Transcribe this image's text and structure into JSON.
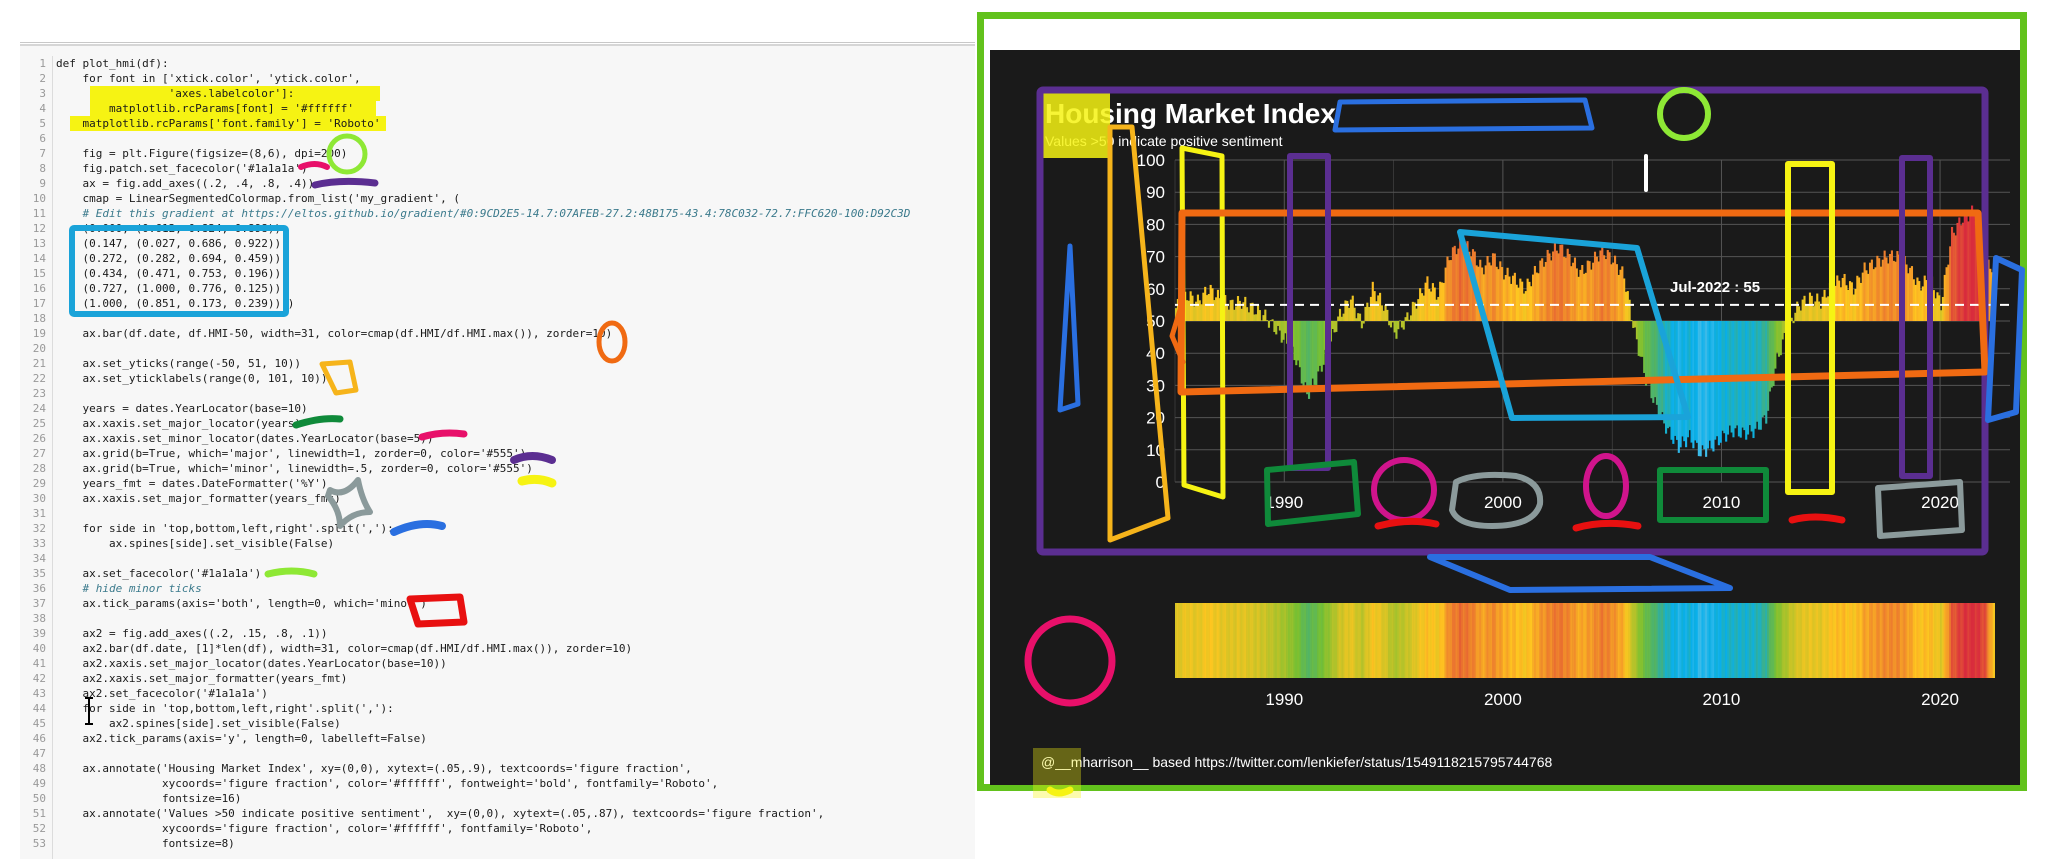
{
  "code_lines": [
    "def plot_hmi(df):",
    "    for font in ['xtick.color', 'ytick.color',",
    "                 'axes.labelcolor']:",
    "        matplotlib.rcParams[font] = '#ffffff'",
    "    matplotlib.rcParams['font.family'] = 'Roboto'",
    "",
    "    fig = plt.Figure(figsize=(8,6), dpi=200)",
    "    fig.patch.set_facecolor('#1a1a1a')",
    "    ax = fig.add_axes((.2, .4, .8, .4))",
    "    cmap = LinearSegmentedColormap.from_list('my_gradient', (",
    "    # Edit this gradient at https://eltos.github.io/gradient/#0:9CD2E5-14.7:07AFEB-27.2:48B175-43.4:78C032-72.7:FFC620-100:D92C3D",
    "    (0.000, (0.612, 0.824, 0.898)),",
    "    (0.147, (0.027, 0.686, 0.922)),",
    "    (0.272, (0.282, 0.694, 0.459)),",
    "    (0.434, (0.471, 0.753, 0.196)),",
    "    (0.727, (1.000, 0.776, 0.125)),",
    "    (1.000, (0.851, 0.173, 0.239))))",
    "",
    "    ax.bar(df.date, df.HMI-50, width=31, color=cmap(df.HMI/df.HMI.max()), zorder=10)",
    "",
    "    ax.set_yticks(range(-50, 51, 10))",
    "    ax.set_yticklabels(range(0, 101, 10))",
    "",
    "    years = dates.YearLocator(base=10)",
    "    ax.xaxis.set_major_locator(years)",
    "    ax.xaxis.set_minor_locator(dates.YearLocator(base=5))",
    "    ax.grid(b=True, which='major', linewidth=1, zorder=0, color='#555')",
    "    ax.grid(b=True, which='minor', linewidth=.5, zorder=0, color='#555')",
    "    years_fmt = dates.DateFormatter('%Y')",
    "    ax.xaxis.set_major_formatter(years_fmt)",
    "",
    "    for side in 'top,bottom,left,right'.split(','):",
    "        ax.spines[side].set_visible(False)",
    "",
    "    ax.set_facecolor('#1a1a1a')",
    "    # hide minor ticks",
    "    ax.tick_params(axis='both', length=0, which='minor')",
    "",
    "    ax2 = fig.add_axes((.2, .15, .8, .1))",
    "    ax2.bar(df.date, [1]*len(df), width=31, color=cmap(df.HMI/df.HMI.max()), zorder=10)",
    "    ax2.xaxis.set_major_locator(dates.YearLocator(base=10))",
    "    ax2.xaxis.set_major_formatter(years_fmt)",
    "    ax2.set_facecolor('#1a1a1a')",
    "    for side in 'top,bottom,left,right'.split(','):",
    "        ax2.spines[side].set_visible(False)",
    "    ax2.tick_params(axis='y', length=0, labelleft=False)",
    "",
    "    ax.annotate('Housing Market Index', xy=(0,0), xytext=(.05,.9), textcoords='figure fraction',",
    "                xycoords='figure fraction', color='#ffffff', fontweight='bold', fontfamily='Roboto',",
    "                fontsize=16)",
    "    ax.annotate('Values >50 indicate positive sentiment',  xy=(0,0), xytext=(.05,.87), textcoords='figure fraction',",
    "                xycoords='figure fraction', color='#ffffff', fontfamily='Roboto',",
    "                fontsize=8)"
  ],
  "comment_line_numbers": [
    11,
    36
  ],
  "chart_data": {
    "type": "bar",
    "title": "Housing Market Index",
    "subtitle": "Values >50 indicate positive sentiment",
    "footer": "@__mharrison__ based https://twitter.com/lenkiefer/status/1549118215795744768",
    "annotation": "Jul-2022 : 55",
    "reference_line": 55,
    "ylim": [
      0,
      100
    ],
    "yticks": [
      "0",
      "10",
      "20",
      "30",
      "40",
      "50",
      "60",
      "70",
      "80",
      "90",
      "100"
    ],
    "xticks": [
      "1990",
      "2000",
      "2010",
      "2020"
    ],
    "xlim": [
      1985.0,
      2023.2
    ],
    "baseline": 50,
    "series": [
      {
        "x": [
          1985.0,
          1985.5,
          1986.0,
          1986.5,
          1987.0,
          1987.5,
          1988.0,
          1988.5,
          1989.0,
          1989.5,
          1990.0,
          1990.5,
          1991.0,
          1991.5,
          1992.0,
          1992.5,
          1993.0,
          1993.5,
          1994.0,
          1994.5,
          1995.0,
          1995.5,
          1996.0,
          1996.5,
          1997.0,
          1997.5,
          1998.0,
          1998.5,
          1999.0,
          1999.5,
          2000.0,
          2000.5,
          2001.0,
          2001.5,
          2002.0,
          2002.5,
          2003.0,
          2003.5,
          2004.0,
          2004.5,
          2005.0,
          2005.5,
          2006.0,
          2006.5,
          2007.0,
          2007.5,
          2008.0,
          2008.5,
          2009.0,
          2009.5,
          2010.0,
          2010.5,
          2011.0,
          2011.5,
          2012.0,
          2012.5,
          2013.0,
          2013.5,
          2014.0,
          2014.5,
          2015.0,
          2015.5,
          2016.0,
          2016.5,
          2017.0,
          2017.5,
          2018.0,
          2018.5,
          2019.0,
          2019.5,
          2020.0,
          2020.5,
          2021.0,
          2021.5,
          2022.0,
          2022.5
        ],
        "y": [
          54,
          58,
          56,
          60,
          57,
          55,
          56,
          54,
          52,
          48,
          44,
          38,
          27,
          33,
          42,
          52,
          57,
          49,
          60,
          55,
          46,
          50,
          56,
          62,
          58,
          70,
          74,
          72,
          66,
          70,
          65,
          63,
          60,
          66,
          70,
          73,
          70,
          65,
          68,
          72,
          69,
          64,
          46,
          32,
          23,
          16,
          11,
          14,
          9,
          11,
          14,
          16,
          15,
          16,
          20,
          38,
          48,
          55,
          57,
          56,
          61,
          63,
          60,
          66,
          68,
          70,
          70,
          67,
          61,
          63,
          55,
          77,
          82,
          84,
          79,
          55
        ]
      }
    ],
    "strip_colors": true
  },
  "colors": {
    "figure_bg": "#1a1a1a",
    "grid": "#555555",
    "refline": "#ffffff",
    "frame": "#62c21c",
    "highlight": "#f6f313"
  }
}
